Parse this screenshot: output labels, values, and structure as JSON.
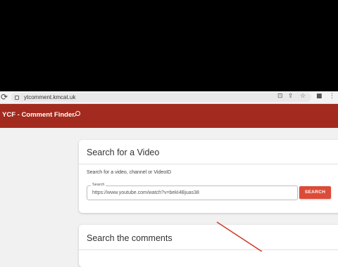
{
  "browser": {
    "url": "ytcomment.kmcat.uk",
    "icons": [
      "reload-icon",
      "site-info-icon",
      "install-app-icon",
      "share-icon",
      "bookmark-star-icon",
      "extension-icon",
      "more-icon"
    ]
  },
  "header": {
    "title": "YCF - Comment Finder",
    "color": "#a32a1e"
  },
  "search_card": {
    "title": "Search for a Video",
    "hint": "Search for a video, channel or VideoID",
    "field_label": "Search",
    "field_value": "https://www.youtube.com/watch?v=bekI4Bjuas38",
    "button_label": "SEARCH",
    "button_color": "#dc4b38"
  },
  "comments_card": {
    "title": "Search the comments"
  }
}
